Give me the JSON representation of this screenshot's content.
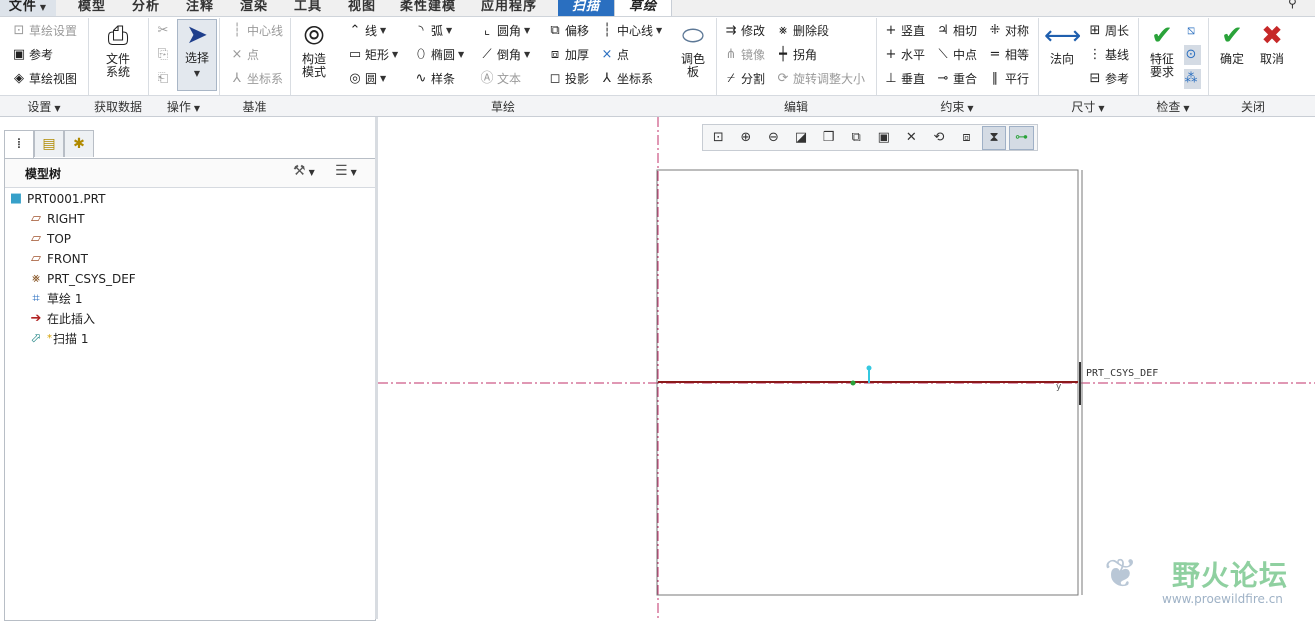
{
  "menubar": {
    "tabs": [
      {
        "label": "文件",
        "type": "file",
        "has_caret": true
      },
      {
        "label": "模型",
        "type": "normal"
      },
      {
        "label": "分析",
        "type": "normal"
      },
      {
        "label": "注释",
        "type": "normal"
      },
      {
        "label": "渲染",
        "type": "normal"
      },
      {
        "label": "工具",
        "type": "normal"
      },
      {
        "label": "视图",
        "type": "normal"
      },
      {
        "label": "柔性建模",
        "type": "normal"
      },
      {
        "label": "应用程序",
        "type": "normal"
      },
      {
        "label": "扫描",
        "type": "context"
      },
      {
        "label": "草绘",
        "type": "active"
      }
    ]
  },
  "ribbon": {
    "settings": {
      "sketch_setup": "草绘设置",
      "references": "参考",
      "sketch_view": "草绘视图"
    },
    "get_data": {
      "file_system": "文件\n系统"
    },
    "operations": {
      "select": "选择"
    },
    "datum": {
      "centerline": "中心线",
      "point": "点",
      "csys": "坐标系"
    },
    "sketch": {
      "construction_mode": "构造\n模式",
      "line": "线",
      "rectangle": "矩形",
      "circle": "圆",
      "arc": "弧",
      "ellipse": "椭圆",
      "spline": "样条",
      "fillet": "圆角",
      "chamfer": "倒角",
      "text": "文本",
      "offset": "偏移",
      "thicken": "加厚",
      "project": "投影",
      "centerline": "中心线",
      "point": "点",
      "csys": "坐标系",
      "palette": "调色\n板"
    },
    "edit": {
      "modify": "修改",
      "delete_segment": "删除段",
      "mirror": "镜像",
      "corner": "拐角",
      "divide": "分割",
      "rotate_resize": "旋转调整大小"
    },
    "constrain": {
      "vertical": "竖直",
      "tangent": "相切",
      "symmetric": "对称",
      "horizontal": "水平",
      "midpoint": "中点",
      "equal": "相等",
      "perpendicular": "垂直",
      "coincident": "重合",
      "parallel": "平行"
    },
    "dimension": {
      "normal": "法向",
      "perimeter": "周长",
      "baseline": "基线",
      "reference": "参考"
    },
    "inspect": {
      "feature_requirements": "特征\n要求"
    },
    "close": {
      "ok": "确定",
      "cancel": "取消"
    }
  },
  "groups": [
    "设置",
    "获取数据",
    "操作",
    "基准",
    "草绘",
    "编辑",
    "约束",
    "尺寸",
    "检查",
    "关闭"
  ],
  "model_tree": {
    "title": "模型树",
    "items": [
      {
        "label": "PRT0001.PRT",
        "icon": "part-icon"
      },
      {
        "label": "RIGHT",
        "icon": "datum-plane-icon"
      },
      {
        "label": "TOP",
        "icon": "datum-plane-icon"
      },
      {
        "label": "FRONT",
        "icon": "datum-plane-icon"
      },
      {
        "label": "PRT_CSYS_DEF",
        "icon": "csys-icon"
      },
      {
        "label": "草绘 1",
        "icon": "sketch-icon"
      },
      {
        "label": "在此插入",
        "icon": "insert-here-icon"
      },
      {
        "label": "扫描 1",
        "icon": "sweep-icon"
      }
    ]
  },
  "canvas": {
    "csys_label": "PRT_CSYS_DEF"
  },
  "watermark": {
    "cn": "野火论坛",
    "url": "www.proewildfire.cn"
  },
  "colors": {
    "context_tab": "#2a6fc0",
    "centerline": "#c0306a",
    "sketch_line": "#8b1a1a",
    "ok": "#2aa33a",
    "cancel": "#c62828"
  }
}
